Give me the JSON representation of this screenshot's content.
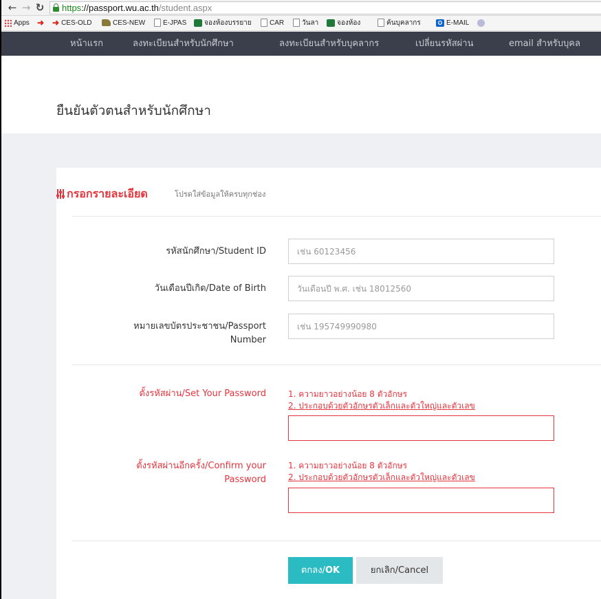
{
  "browser": {
    "url_scheme": "https",
    "url_host": "://passport.wu.ac.th",
    "url_path": "/student.aspx",
    "bookmarks": [
      {
        "label": "Apps",
        "icon": "apps-grid-icon"
      },
      {
        "label": "",
        "icon": "red-arrow-icon"
      },
      {
        "label": "CES-OLD",
        "icon": "red-arrow-icon"
      },
      {
        "label": "CES-NEW",
        "icon": "graduation-cap-icon"
      },
      {
        "label": "E-JPAS",
        "icon": "page-icon"
      },
      {
        "label": "จองห้องบรรยาย",
        "icon": "spreadsheet-icon"
      },
      {
        "label": "CAR",
        "icon": "page-icon"
      },
      {
        "label": "วันลา",
        "icon": "page-icon"
      },
      {
        "label": "จองห้อง",
        "icon": "spreadsheet-icon"
      },
      {
        "label": "ค้นบุคลากร",
        "icon": "page-icon"
      },
      {
        "label": "E-MAIL",
        "icon": "outlook-icon"
      }
    ]
  },
  "site_nav": [
    "หน้าแรก",
    "ลงทะเบียนสำหรับนักศึกษา",
    "ลงทะเบียนสำหรับบุคลากร",
    "เปลี่ยนรหัสผ่าน",
    "email สำหรับบุคล"
  ],
  "page": {
    "title": "ยืนยันตัวตนสำหรับนักศึกษา"
  },
  "form": {
    "heading": "กรอกรายละเอียด",
    "subheading": "โปรดใส่ข้อมูลให้ครบทุกช่อง",
    "student_id": {
      "label": "รหัสนักศึกษา/Student ID",
      "placeholder": "เช่น 60123456",
      "value": ""
    },
    "dob": {
      "label": "วันเดือนปีเกิด/Date of Birth",
      "placeholder": "วันเดือนปี พ.ศ. เช่น 18012560",
      "value": ""
    },
    "passport": {
      "label_line1": "หมายเลขบัตรประชาชน/Passport",
      "label_line2": "Number",
      "placeholder": "เช่น 195749990980",
      "value": ""
    },
    "password": {
      "label": "ตั้งรหัสผ่าน/Set Your Password",
      "hint1": "1. ความยาวอย่างน้อย 8 ตัวอักษร",
      "hint2": "2. ประกอบด้วยตัวอักษรตัวเล็กและตัวใหญ่และตัวเลข"
    },
    "confirm_password": {
      "label_line1": "ตั้งรหัสผ่านอีกครั้ง/Confirm your",
      "label_line2": "Password",
      "hint1": "1. ความยาวอย่างน้อย 8 ตัวอักษร",
      "hint2": "2. ประกอบด้วยตัวอักษรตัวเล็กและตัวใหญ่และตัวเลข"
    },
    "ok_prefix": "ตกลง/",
    "ok_suffix": "OK",
    "cancel": "ยกเลิก/Cancel"
  },
  "colors": {
    "accent_red": "#e5343d",
    "ok_teal": "#2bbcc3",
    "nav_bg": "#3a3f4b",
    "band_bg": "#eef0f4"
  }
}
